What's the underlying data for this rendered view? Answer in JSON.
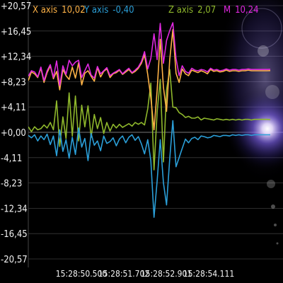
{
  "chart_data": {
    "type": "line",
    "xlabel": "",
    "ylabel": "",
    "ylim": [
      -20.57,
      20.57
    ],
    "y_ticks": [
      "+20,57",
      "+16,45",
      "+12,34",
      "+8,23",
      "+4,11",
      "+0,00",
      "-4,11",
      "-8,23",
      "-12,34",
      "-16,45",
      "-20,57"
    ],
    "x_ticks": [
      "15:28:50.500",
      "15:28:51.702",
      "15:28:52.901",
      "15:28:54.111"
    ],
    "grid": true,
    "legend_position": "top",
    "background": "#000000",
    "series": [
      {
        "name": "X axis",
        "legend_value": "10,02",
        "color": "#ffb347",
        "values": [
          8.4,
          9.8,
          9.5,
          8.9,
          10.4,
          8.1,
          9.7,
          10.8,
          8.7,
          9.9,
          6.9,
          10.2,
          9.2,
          8.6,
          10.6,
          8.8,
          11.3,
          7.7,
          9.6,
          10.0,
          9.1,
          8.3,
          10.5,
          9.0,
          9.9,
          10.3,
          8.9,
          9.5,
          9.7,
          10.1,
          9.4,
          9.8,
          10.2,
          9.6,
          9.9,
          10.4,
          11.2,
          12.6,
          9.4,
          5.6,
          0.4,
          6.8,
          15.1,
          7.3,
          3.4,
          11.8,
          16.7,
          9.6,
          8.1,
          10.3,
          9.5,
          9.2,
          10.1,
          9.9,
          9.7,
          10.0,
          9.8,
          9.5,
          10.2,
          9.9,
          10.0,
          9.8,
          9.9,
          10.1,
          9.9,
          10.0,
          10.0,
          9.9,
          10.0,
          10.0,
          10.1,
          10.0,
          10.0,
          10.0,
          10.0,
          10.0,
          10.0,
          10.02
        ]
      },
      {
        "name": "Y axis",
        "legend_value": "-0,40",
        "color": "#2b9fd8",
        "values": [
          -0.5,
          -0.9,
          -0.4,
          -1.4,
          -0.6,
          -1.2,
          -0.3,
          -2.0,
          -0.6,
          -3.8,
          0.4,
          -3.1,
          -1.2,
          -4.2,
          -0.8,
          -3.6,
          0.7,
          -2.4,
          -1.0,
          -4.6,
          -0.2,
          -2.1,
          -1.4,
          -3.0,
          -0.6,
          -1.8,
          -1.5,
          -0.9,
          -2.2,
          -1.1,
          -0.6,
          -1.7,
          -0.8,
          -0.4,
          -1.3,
          -0.7,
          -1.9,
          -3.5,
          -1.2,
          -4.6,
          -13.8,
          -7.9,
          -1.2,
          -8.2,
          -11.8,
          -4.3,
          1.9,
          -5.6,
          -4.1,
          -2.6,
          -1.1,
          -1.7,
          -1.0,
          -0.8,
          -1.2,
          -0.6,
          -0.7,
          -0.9,
          -0.8,
          -0.5,
          -0.6,
          -0.7,
          -0.5,
          -0.5,
          -0.6,
          -0.4,
          -0.5,
          -0.4,
          -0.5,
          -0.4,
          -0.4,
          -0.5,
          -0.4,
          -0.4,
          -0.4,
          -0.4,
          -0.4,
          -0.4
        ]
      },
      {
        "name": "Z axis",
        "legend_value": "2,07",
        "color": "#8fb82c",
        "values": [
          0.9,
          0.1,
          0.9,
          0.4,
          0.6,
          1.2,
          0.7,
          1.6,
          0.4,
          5.1,
          -2.3,
          2.5,
          -1.0,
          6.4,
          -0.6,
          5.9,
          -1.4,
          4.4,
          0.9,
          4.3,
          -0.8,
          2.9,
          0.6,
          2.4,
          -0.2,
          1.6,
          0.2,
          1.3,
          0.7,
          1.3,
          0.8,
          1.1,
          1.4,
          1.0,
          1.6,
          1.3,
          1.6,
          1.2,
          3.8,
          8.0,
          -6.1,
          3.3,
          8.6,
          -4.8,
          6.9,
          10.2,
          4.1,
          4.0,
          3.2,
          2.9,
          2.4,
          2.6,
          2.3,
          2.3,
          2.5,
          2.0,
          2.3,
          2.2,
          2.1,
          2.0,
          2.2,
          2.1,
          2.0,
          2.1,
          2.0,
          2.1,
          2.0,
          2.1,
          2.0,
          2.1,
          2.1,
          2.0,
          2.1,
          2.1,
          2.1,
          2.1,
          2.1,
          2.07
        ]
      },
      {
        "name": "M",
        "legend_value": "10,24",
        "color": "#e028e0",
        "values": [
          9.1,
          10.0,
          9.8,
          9.0,
          10.6,
          8.4,
          10.0,
          11.0,
          8.9,
          11.6,
          7.6,
          10.8,
          9.4,
          11.7,
          10.8,
          11.4,
          11.7,
          8.9,
          10.0,
          11.1,
          9.3,
          8.8,
          10.7,
          9.5,
          10.0,
          10.5,
          9.2,
          9.6,
          9.9,
          10.2,
          9.5,
          10.0,
          10.4,
          9.7,
          10.1,
          10.6,
          11.5,
          13.1,
          10.3,
          12.0,
          16.0,
          11.8,
          17.7,
          11.2,
          14.9,
          16.5,
          17.8,
          12.0,
          9.2,
          10.8,
          9.9,
          9.6,
          10.4,
          10.1,
          10.0,
          10.2,
          10.1,
          9.8,
          10.4,
          10.1,
          10.2,
          10.0,
          10.1,
          10.3,
          10.1,
          10.2,
          10.2,
          10.1,
          10.2,
          10.2,
          10.3,
          10.2,
          10.2,
          10.2,
          10.2,
          10.2,
          10.2,
          10.24
        ]
      }
    ]
  }
}
